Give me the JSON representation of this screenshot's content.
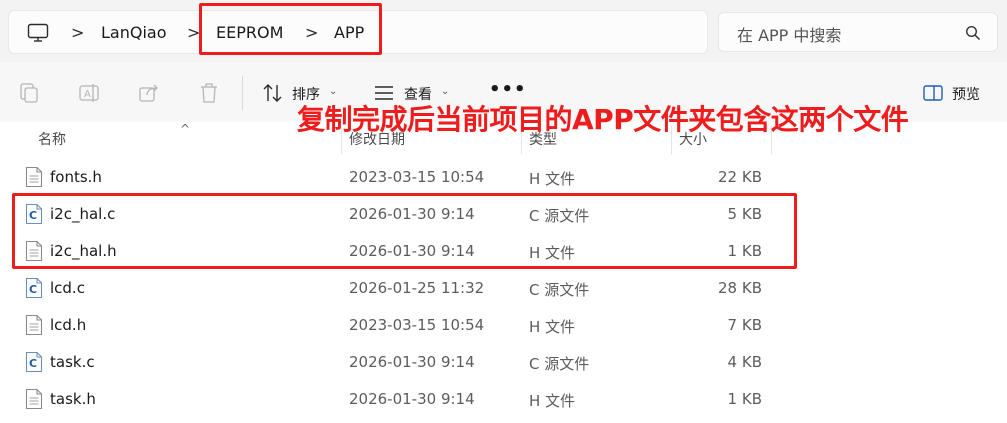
{
  "address": {
    "crumbs": [
      "LanQiao",
      "EEPROM",
      "APP"
    ],
    "chevron": ">"
  },
  "search": {
    "placeholder": "在 APP 中搜索"
  },
  "toolbar": {
    "sort_label": "排序",
    "view_label": "查看",
    "preview_label": "预览"
  },
  "columns": {
    "name": "名称",
    "date": "修改日期",
    "type": "类型",
    "size": "大小"
  },
  "files": [
    {
      "name": "fonts.h",
      "date": "2023-03-15 10:54",
      "type": "H 文件",
      "size": "22 KB",
      "icon": "header-file-icon"
    },
    {
      "name": "i2c_hal.c",
      "date": "2026-01-30 9:14",
      "type": "C 源文件",
      "size": "5 KB",
      "icon": "c-source-file-icon"
    },
    {
      "name": "i2c_hal.h",
      "date": "2026-01-30 9:14",
      "type": "H 文件",
      "size": "1 KB",
      "icon": "header-file-icon"
    },
    {
      "name": "lcd.c",
      "date": "2026-01-25 11:32",
      "type": "C 源文件",
      "size": "28 KB",
      "icon": "c-source-file-icon"
    },
    {
      "name": "lcd.h",
      "date": "2023-03-15 10:54",
      "type": "H 文件",
      "size": "7 KB",
      "icon": "header-file-icon"
    },
    {
      "name": "task.c",
      "date": "2026-01-30 9:14",
      "type": "C 源文件",
      "size": "4 KB",
      "icon": "c-source-file-icon"
    },
    {
      "name": "task.h",
      "date": "2026-01-30 9:14",
      "type": "H 文件",
      "size": "1 KB",
      "icon": "header-file-icon"
    }
  ],
  "annotation": {
    "text": "复制完成后当前项目的APP文件夹包含这两个文件",
    "color": "#ee1c1c"
  }
}
